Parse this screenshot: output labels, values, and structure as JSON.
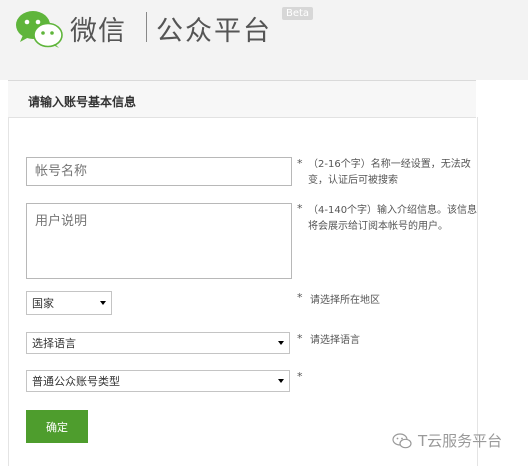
{
  "header": {
    "brand": "微信",
    "platform": "公众平台",
    "beta": "Beta"
  },
  "form": {
    "section_title": "请输入账号基本信息",
    "account_name_placeholder": "帐号名称",
    "account_name_note": "（2-16个字）名称一经设置，无法改变，认证后可被搜索",
    "description_placeholder": "用户说明",
    "description_note": "（4-140个字）输入介绍信息。该信息将会展示给订阅本帐号的用户。",
    "country_value": "国家",
    "country_note": "请选择所在地区",
    "language_value": "选择语言",
    "language_note": "请选择语言",
    "account_type_value": "普通公众账号类型",
    "required_mark": "*",
    "submit_label": "确定"
  },
  "watermark": {
    "text": "T云服务平台"
  },
  "icons": {
    "logo": "wechat-logo-icon",
    "watermark": "wechat-logo-icon"
  },
  "colors": {
    "submit_button": "#4e9d2d",
    "logo_green": "#5fb53b",
    "header_bg": "#f3f3f3"
  }
}
